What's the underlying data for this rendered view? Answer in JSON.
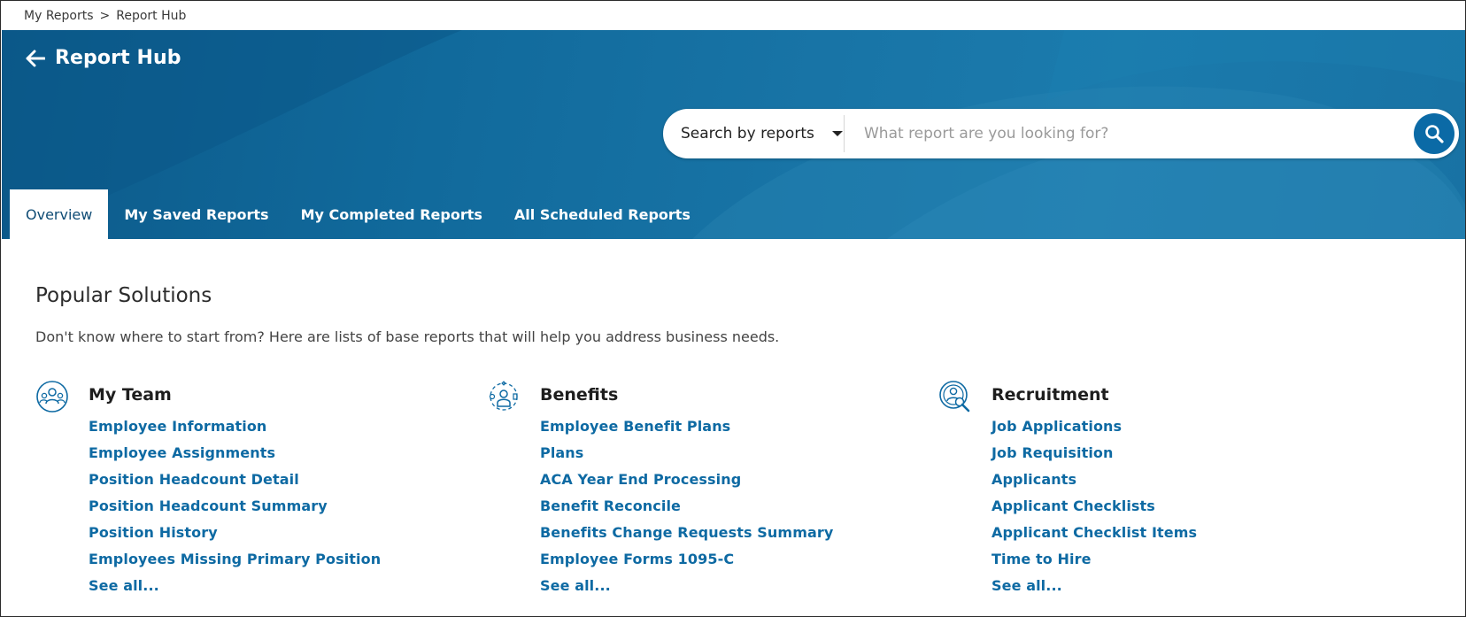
{
  "breadcrumb": {
    "items": [
      "My Reports",
      "Report Hub"
    ],
    "separator": ">"
  },
  "header": {
    "title": "Report Hub"
  },
  "search": {
    "type_label": "Search by reports",
    "placeholder": "What report are you looking for?",
    "value": ""
  },
  "tabs": [
    {
      "label": "Overview",
      "active": true
    },
    {
      "label": "My Saved Reports",
      "active": false
    },
    {
      "label": "My Completed Reports",
      "active": false
    },
    {
      "label": "All Scheduled Reports",
      "active": false
    }
  ],
  "popular": {
    "title": "Popular Solutions",
    "description": "Don't know where to start from? Here are lists of base reports that will help you address business needs.",
    "columns": [
      {
        "title": "My Team",
        "icon": "team-icon",
        "links": [
          "Employee Information",
          "Employee Assignments",
          "Position Headcount Detail",
          "Position Headcount Summary",
          "Position History",
          "Employees Missing Primary Position"
        ],
        "see_all": "See all..."
      },
      {
        "title": "Benefits",
        "icon": "benefits-icon",
        "links": [
          "Employee Benefit Plans",
          "Plans",
          "ACA Year End Processing",
          "Benefit Reconcile",
          "Benefits Change Requests Summary",
          "Employee Forms 1095-C"
        ],
        "see_all": "See all..."
      },
      {
        "title": "Recruitment",
        "icon": "recruitment-icon",
        "links": [
          "Job Applications",
          "Job Requisition",
          "Applicants",
          "Applicant Checklists",
          "Applicant Checklist Items",
          "Time to Hire"
        ],
        "see_all": "See all..."
      }
    ]
  },
  "colors": {
    "hero": "#116a9c",
    "link": "#0e6aa3",
    "search_button": "#0b6aa6",
    "active_tab_text": "#0f4c75"
  }
}
